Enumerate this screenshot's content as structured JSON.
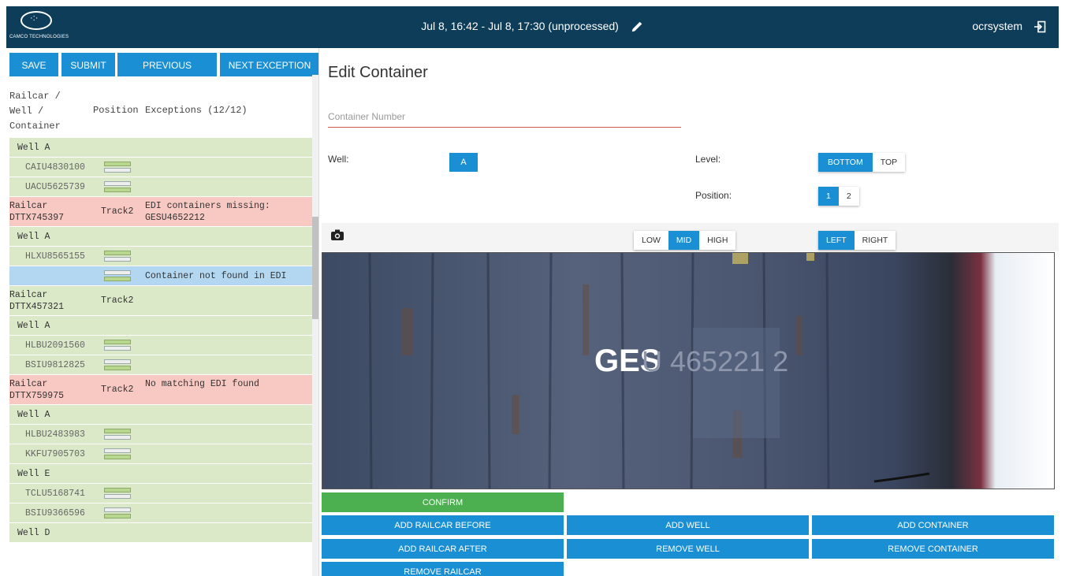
{
  "header": {
    "logo_text": "CAMCO TECHNOLOGIES",
    "time_range": "Jul 8, 16:42 - Jul 8, 17:30 (unprocessed)",
    "username": "ocrsystem",
    "icons": [
      "pencil-icon",
      "exit-icon"
    ]
  },
  "toolbar": {
    "save": "SAVE",
    "submit": "SUBMIT",
    "previous": "PREVIOUS",
    "next": "NEXT EXCEPTION"
  },
  "list_header": {
    "col1_line1": "Railcar /",
    "col1_line2": "Well /",
    "col1_line3": "Container",
    "col2": "Position",
    "col3": "Exceptions (12/12)"
  },
  "rows": [
    {
      "type": "well",
      "text": "Well A"
    },
    {
      "type": "container",
      "id": "CAIU4830100",
      "boxes": "gw"
    },
    {
      "type": "container",
      "id": "UACU5625739",
      "boxes": "wg"
    },
    {
      "type": "railcar",
      "line1": "Railcar",
      "line2": "DTTX745397",
      "track": "Track2",
      "exception1": "EDI containers missing:",
      "exception2": "GESU4652212",
      "color": "red"
    },
    {
      "type": "well",
      "text": "Well A"
    },
    {
      "type": "container",
      "id": "HLXU8565155",
      "boxes": "gw"
    },
    {
      "type": "selected",
      "id": "",
      "boxes": "wg",
      "exception": "Container not found in EDI"
    },
    {
      "type": "railcar",
      "line1": "Railcar",
      "line2": "DTTX457321",
      "track": "Track2",
      "exception1": "",
      "exception2": "",
      "color": "green"
    },
    {
      "type": "well",
      "text": "Well A"
    },
    {
      "type": "container",
      "id": "HLBU2091560",
      "boxes": "gw"
    },
    {
      "type": "container",
      "id": "BSIU9812825",
      "boxes": "wg"
    },
    {
      "type": "railcar",
      "line1": "Railcar",
      "line2": "DTTX759975",
      "track": "Track2",
      "exception1": "No matching EDI found",
      "exception2": "",
      "color": "red"
    },
    {
      "type": "well",
      "text": "Well A"
    },
    {
      "type": "container",
      "id": "HLBU2483983",
      "boxes": "gw"
    },
    {
      "type": "container",
      "id": "KKFU7905703",
      "boxes": "wg"
    },
    {
      "type": "well",
      "text": "Well E"
    },
    {
      "type": "container",
      "id": "TCLU5168741",
      "boxes": "gw"
    },
    {
      "type": "container",
      "id": "BSIU9366596",
      "boxes": "wg"
    },
    {
      "type": "well",
      "text": "Well D"
    }
  ],
  "edit": {
    "title": "Edit Container",
    "container_placeholder": "Container Number",
    "well_label": "Well:",
    "well_value": "A",
    "level_label": "Level:",
    "level_options": [
      "BOTTOM",
      "TOP"
    ],
    "level_selected": "BOTTOM",
    "position_label": "Position:",
    "position_options": [
      "1",
      "2"
    ],
    "position_selected": "1",
    "image_levels": [
      "LOW",
      "MID",
      "HIGH"
    ],
    "image_level_selected": "MID",
    "image_sides": [
      "LEFT",
      "RIGHT"
    ],
    "image_side_selected": "LEFT",
    "photo_text": "GES",
    "photo_text_faded": "U 465221 2"
  },
  "actions": {
    "confirm": "CONFIRM",
    "add_railcar_before": "ADD RAILCAR BEFORE",
    "add_well": "ADD WELL",
    "add_container": "ADD CONTAINER",
    "add_railcar_after": "ADD RAILCAR AFTER",
    "remove_well": "REMOVE WELL",
    "remove_container": "REMOVE CONTAINER",
    "remove_railcar": "REMOVE RAILCAR"
  },
  "colors": {
    "header": "#0e3d5a",
    "primary": "#1a8fd3",
    "confirm": "#4caf50",
    "row_green": "#dbe9c9",
    "row_red": "#f8c8c3",
    "row_blue": "#b3d7f1"
  }
}
